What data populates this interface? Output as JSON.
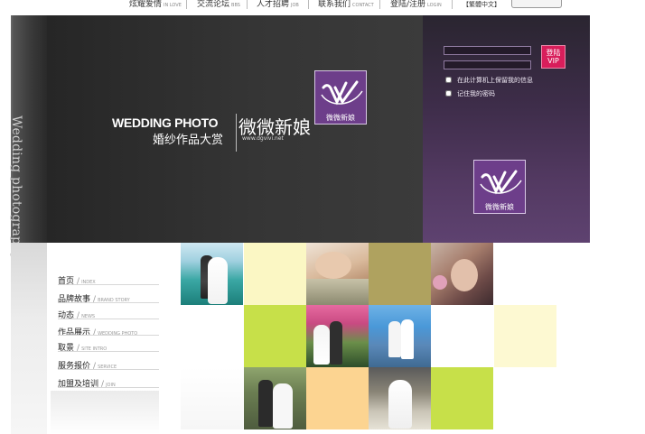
{
  "nav": {
    "items": [
      {
        "cn": "炫耀爱情",
        "en": "IN LOVE"
      },
      {
        "cn": "交流论坛",
        "en": "BBS"
      },
      {
        "cn": "人才招聘",
        "en": "JOB"
      },
      {
        "cn": "联系我们",
        "en": "CONTACT"
      },
      {
        "cn": "登陆/注册",
        "en": "LOGIN"
      }
    ],
    "language_label": "【繁體中文】"
  },
  "banner": {
    "side_text": "Wedding photography",
    "title_en": "WEDDING PHOTO",
    "title_cn": "婚纱作品大赏",
    "brand_cn": "微微新娘",
    "url": "www.dgvivi.net",
    "logo_caption": "微微新娘"
  },
  "login": {
    "button_label": "登陆 VIP",
    "remember_computer": "在此计算机上保留我的信息",
    "remember_password": "记住我的密码",
    "logo_caption": "微微新娘"
  },
  "menu": [
    {
      "cn": "首页",
      "en": "INDEX"
    },
    {
      "cn": "品牌故事",
      "en": "BRAND STORY"
    },
    {
      "cn": "动态",
      "en": "NEWS"
    },
    {
      "cn": "作品展示",
      "en": "WEDDING PHOTO"
    },
    {
      "cn": "取景",
      "en": "SITE INTRO"
    },
    {
      "cn": "服务报价",
      "en": "SERVICE"
    },
    {
      "cn": "加盟及培训",
      "en": "JOIN"
    }
  ],
  "colors": {
    "brand_purple": "#6d3e8a",
    "login_button": "#d81e5b",
    "tile_lime": "#c7e049",
    "tile_cream": "#fbf7c4",
    "tile_olive": "#afa25f",
    "tile_peach": "#fcd491"
  }
}
